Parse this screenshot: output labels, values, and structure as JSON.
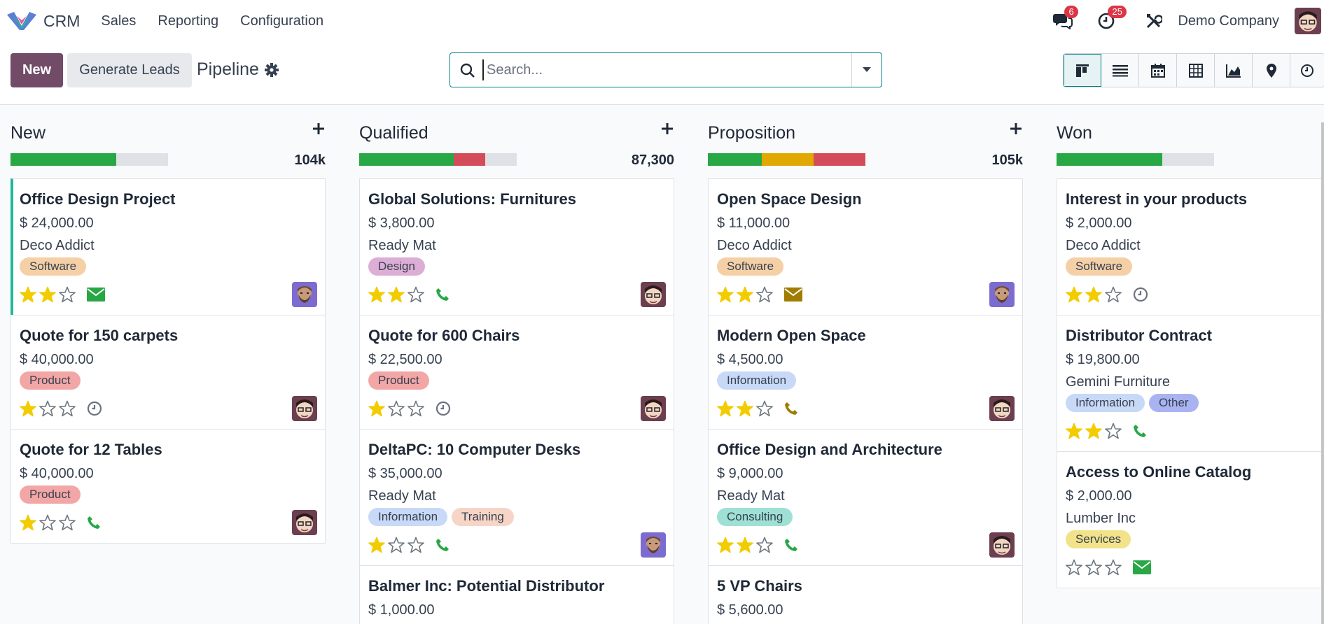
{
  "app": {
    "name": "CRM",
    "logo_icon": "odoo-crm-logo"
  },
  "menu": [
    "Sales",
    "Reporting",
    "Configuration"
  ],
  "nav": {
    "messages_badge": "6",
    "activities_badge": "25",
    "company": "Demo Company"
  },
  "control": {
    "new_label": "New",
    "generate_label": "Generate Leads",
    "breadcrumb": "Pipeline",
    "search_placeholder": "Search...",
    "views": [
      "kanban-view-icon",
      "list-view-icon",
      "calendar-view-icon",
      "pivot-view-icon",
      "graph-view-icon",
      "map-view-icon",
      "activity-view-icon"
    ]
  },
  "colors": {
    "primary": "#714b67",
    "accent": "#017e84",
    "progress_green": "#28a745",
    "progress_red": "#d44c59",
    "progress_orange": "#e0a800",
    "star": "#f3cc00",
    "star_empty": "#6c757d",
    "activity_green": "#28a745",
    "activity_amber": "#a07d00"
  },
  "columns": [
    {
      "title": "New",
      "total": "104k",
      "progress": [
        {
          "color": "green",
          "fraction": 0.67
        }
      ],
      "cards": [
        {
          "title": "Office Design Project",
          "amount": "$ 24,000.00",
          "partner": "Deco Addict",
          "tags": [
            {
              "label": "Software",
              "color": "#f5d0a6"
            }
          ],
          "stars": 2,
          "activity": "envelope-icon",
          "activity_color": "green",
          "avatar": "bearded-avatar",
          "accent": true
        },
        {
          "title": "Quote for 150 carpets",
          "amount": "$ 40,000.00",
          "partner": "",
          "tags": [
            {
              "label": "Product",
              "color": "#f3a6a6"
            }
          ],
          "stars": 1,
          "activity": "clock-icon",
          "activity_color": "gray",
          "avatar": "glasses-avatar",
          "accent": false
        },
        {
          "title": "Quote for 12 Tables",
          "amount": "$ 40,000.00",
          "partner": "",
          "tags": [
            {
              "label": "Product",
              "color": "#f3a6a6"
            }
          ],
          "stars": 1,
          "activity": "phone-icon",
          "activity_color": "green",
          "avatar": "glasses-avatar",
          "accent": false
        }
      ]
    },
    {
      "title": "Qualified",
      "total": "87,300",
      "progress": [
        {
          "color": "green",
          "fraction": 0.6
        },
        {
          "color": "red",
          "fraction": 0.2
        }
      ],
      "cards": [
        {
          "title": "Global Solutions: Furnitures",
          "amount": "$ 3,800.00",
          "partner": "Ready Mat",
          "tags": [
            {
              "label": "Design",
              "color": "#dcaed6"
            }
          ],
          "stars": 2,
          "activity": "phone-icon",
          "activity_color": "green",
          "avatar": "glasses-avatar",
          "accent": false
        },
        {
          "title": "Quote for 600 Chairs",
          "amount": "$ 22,500.00",
          "partner": "",
          "tags": [
            {
              "label": "Product",
              "color": "#f3a6a6"
            }
          ],
          "stars": 1,
          "activity": "clock-icon",
          "activity_color": "gray",
          "avatar": "glasses-avatar",
          "accent": false
        },
        {
          "title": "DeltaPC: 10 Computer Desks",
          "amount": "$ 35,000.00",
          "partner": "Ready Mat",
          "tags": [
            {
              "label": "Information",
              "color": "#c7d9f7"
            },
            {
              "label": "Training",
              "color": "#f6d5c6"
            }
          ],
          "stars": 1,
          "activity": "phone-icon",
          "activity_color": "green",
          "avatar": "bearded-avatar",
          "accent": false
        },
        {
          "title": "Balmer Inc: Potential Distributor",
          "amount": "$ 1,000.00",
          "partner": "",
          "tags": [],
          "stars": 0,
          "activity": "",
          "activity_color": "",
          "avatar": "",
          "accent": false
        }
      ]
    },
    {
      "title": "Proposition",
      "total": "105k",
      "progress": [
        {
          "color": "green",
          "fraction": 0.34
        },
        {
          "color": "orange",
          "fraction": 0.33
        },
        {
          "color": "red",
          "fraction": 0.33
        }
      ],
      "cards": [
        {
          "title": "Open Space Design",
          "amount": "$ 11,000.00",
          "partner": "Deco Addict",
          "tags": [
            {
              "label": "Software",
              "color": "#f5d0a6"
            }
          ],
          "stars": 2,
          "activity": "envelope-icon",
          "activity_color": "amber",
          "avatar": "bearded-avatar",
          "accent": false
        },
        {
          "title": "Modern Open Space",
          "amount": "$ 4,500.00",
          "partner": "",
          "tags": [
            {
              "label": "Information",
              "color": "#c7d9f7"
            }
          ],
          "stars": 2,
          "activity": "phone-icon",
          "activity_color": "amber",
          "avatar": "glasses-avatar",
          "accent": false
        },
        {
          "title": "Office Design and Architecture",
          "amount": "$ 9,000.00",
          "partner": "Ready Mat",
          "tags": [
            {
              "label": "Consulting",
              "color": "#9fe0d4"
            }
          ],
          "stars": 2,
          "activity": "phone-icon",
          "activity_color": "green",
          "avatar": "glasses-avatar",
          "accent": false
        },
        {
          "title": "5 VP Chairs",
          "amount": "$ 5,600.00",
          "partner": "",
          "tags": [],
          "stars": 0,
          "activity": "",
          "activity_color": "",
          "avatar": "",
          "accent": false
        }
      ]
    },
    {
      "title": "Won",
      "total": "",
      "progress": [
        {
          "color": "green",
          "fraction": 0.67
        }
      ],
      "cards": [
        {
          "title": "Interest in your products",
          "amount": "$ 2,000.00",
          "partner": "Deco Addict",
          "tags": [
            {
              "label": "Software",
              "color": "#f5d0a6"
            }
          ],
          "stars": 2,
          "activity": "clock-icon",
          "activity_color": "gray",
          "avatar": "",
          "accent": false
        },
        {
          "title": "Distributor Contract",
          "amount": "$ 19,800.00",
          "partner": "Gemini Furniture",
          "tags": [
            {
              "label": "Information",
              "color": "#c7d9f7"
            },
            {
              "label": "Other",
              "color": "#a9b3f2"
            }
          ],
          "stars": 2,
          "activity": "phone-icon",
          "activity_color": "green",
          "avatar": "",
          "accent": false
        },
        {
          "title": "Access to Online Catalog",
          "amount": "$ 2,000.00",
          "partner": "Lumber Inc",
          "tags": [
            {
              "label": "Services",
              "color": "#f2e38a"
            }
          ],
          "stars": 0,
          "activity": "envelope-icon",
          "activity_color": "green",
          "avatar": "",
          "accent": false
        }
      ]
    }
  ]
}
